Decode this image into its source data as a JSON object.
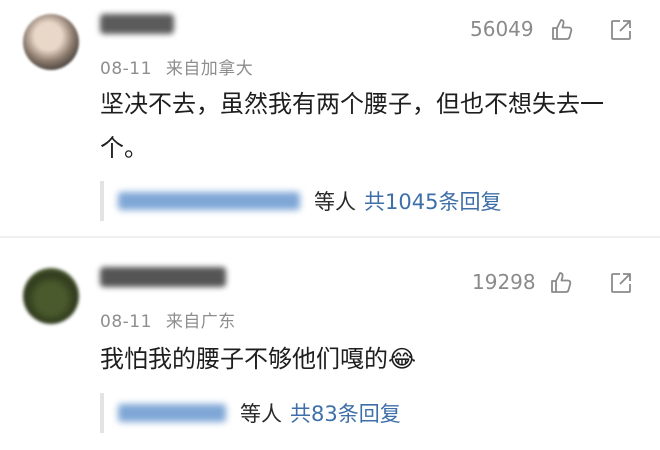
{
  "comments": [
    {
      "date": "08-11",
      "location": "来自加拿大",
      "likes": "56049",
      "text": "坚决不去，虽然我有两个腰子，但也不想失去一个。",
      "replies": {
        "by": "等人",
        "count": "共1045条回复"
      }
    },
    {
      "date": "08-11",
      "location": "来自广东",
      "likes": "19298",
      "text": "我怕我的腰子不够他们嘎的😂",
      "replies": {
        "by": "等人",
        "count": "共83条回复"
      }
    }
  ],
  "colors": {
    "link": "#3e6fa8",
    "meta": "#8e8e8e",
    "icon": "#8a8a8a"
  },
  "icons": [
    "thumbs-up-icon",
    "share-icon"
  ]
}
